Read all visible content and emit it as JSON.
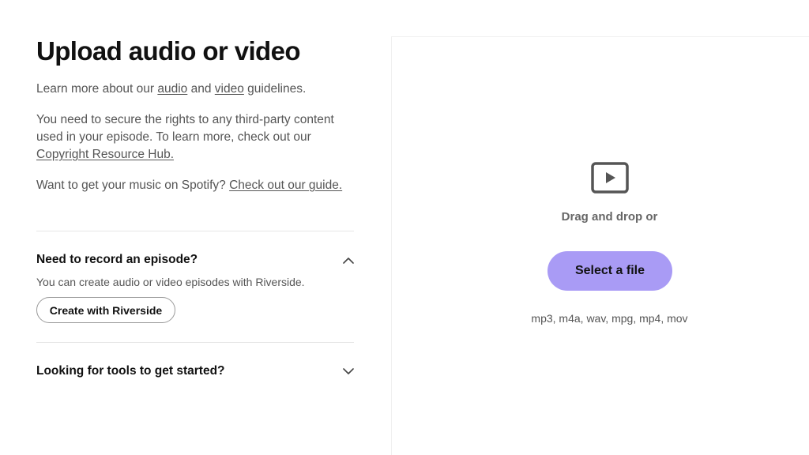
{
  "page": {
    "title": "Upload audio or video"
  },
  "intro": {
    "before": "Learn more about our ",
    "audio_link": "audio",
    "middle": " and ",
    "video_link": "video",
    "after": " guidelines."
  },
  "rights": {
    "text": "You need to secure the rights to any third-party content used in your episode. To learn more, check out our ",
    "link": "Copyright Resource Hub."
  },
  "music": {
    "text": "Want to get your music on Spotify? ",
    "link": "Check out our guide."
  },
  "accordion": [
    {
      "title": "Need to record an episode?",
      "expanded": true,
      "body": "You can create audio or video episodes with Riverside.",
      "button": "Create with Riverside",
      "icon": "chevron-up-icon"
    },
    {
      "title": "Looking for tools to get started?",
      "expanded": false,
      "icon": "chevron-down-icon"
    }
  ],
  "upload": {
    "icon": "video-icon",
    "drag_text": "Drag and drop or",
    "button": "Select a file",
    "formats": "mp3, m4a, wav, mpg, mp4, mov",
    "accent_color": "#a99bf5"
  }
}
